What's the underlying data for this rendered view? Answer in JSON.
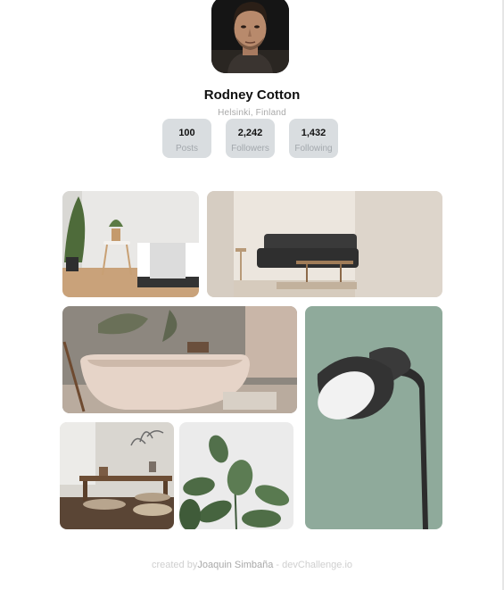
{
  "profile": {
    "name": "Rodney Cotton",
    "location": "Helsinki, Finland",
    "avatar_icon": "portrait-photo"
  },
  "stats": [
    {
      "value": "100",
      "label": "Posts"
    },
    {
      "value": "2,242",
      "label": "Followers"
    },
    {
      "value": "1,432",
      "label": "Following"
    }
  ],
  "gallery": [
    {
      "name": "bedroom-photo"
    },
    {
      "name": "living-room-photo"
    },
    {
      "name": "bathtub-photo"
    },
    {
      "name": "lamp-photo"
    },
    {
      "name": "low-table-photo"
    },
    {
      "name": "plant-photo"
    }
  ],
  "footer": {
    "prefix": "created by",
    "author": "Joaquin Simbaña",
    "suffix": " - devChallenge.io"
  },
  "colors": {
    "stat_background": "#d9dde0",
    "lamp_background": "#8faa9b"
  }
}
